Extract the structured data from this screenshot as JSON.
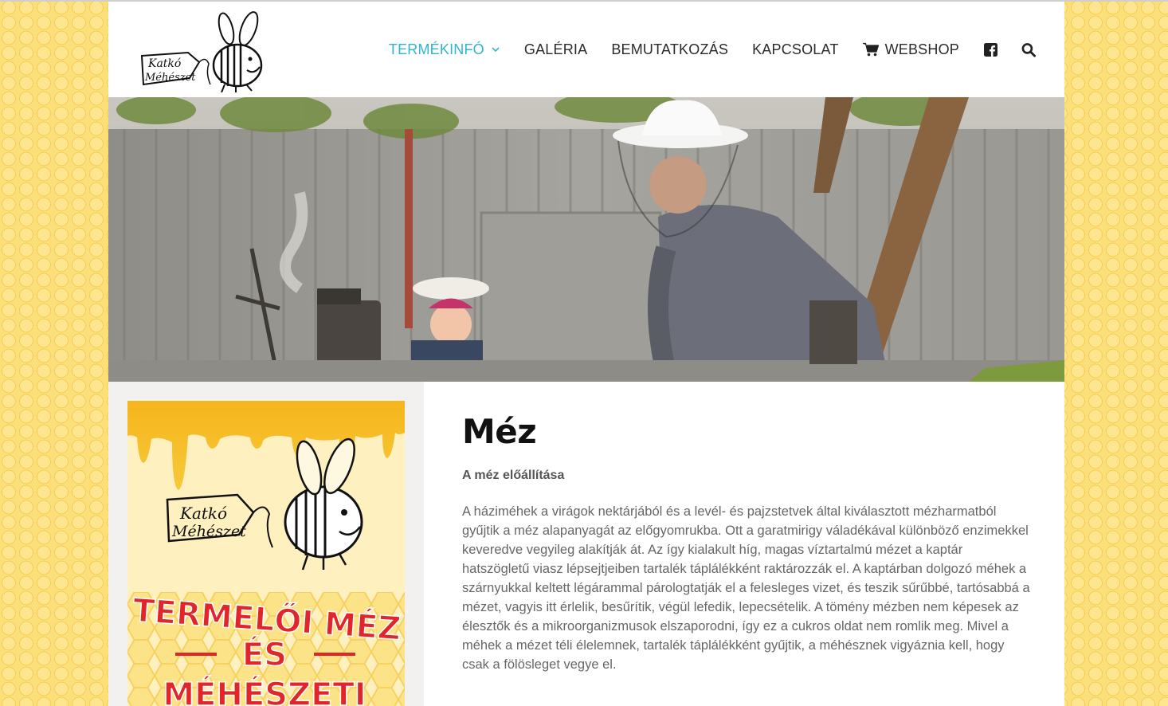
{
  "brand": {
    "logo_line1": "Katkó",
    "logo_line2": "Méhészet"
  },
  "nav": {
    "items": [
      {
        "label": "TERMÉKINFÓ"
      },
      {
        "label": "GALÉRIA"
      },
      {
        "label": "BEMUTATKOZÁS"
      },
      {
        "label": "KAPCSOLAT"
      },
      {
        "label": "WEBSHOP"
      }
    ]
  },
  "poster": {
    "logo_line1": "Katkó",
    "logo_line2": "Méhészet",
    "line1": "TERMELŐI MÉZ",
    "line2": "ÉS",
    "line3": "MÉHÉSZETI"
  },
  "article": {
    "title": "Méz",
    "subtitle": "A méz előállítása",
    "body": "A háziméhek a virágok nektárjából és a levél- és pajzstetvek által kiválasztott mézharmatból gyűjtik a méz alapanyagát az előgyomrukba. Ott a garatmirigy váladékával különböző enzimekkel keveredve vegyileg alakítják át. Az így kialakult híg, magas víztartalmú mézet a kaptár hatszögletű viasz lépsejtjeiben tartalék táplálékként raktározzák el. A kaptárban dolgozó méhek a szárnyukkal keltett légárammal párologtatják el a felesleges vizet, és teszik sűrűbbé, tartósabbá a mézet, vagyis itt érlelik, besűrítik, végül lefedik, lepecsételik. A tömény mézben nem képesek az élesztők és a mikroorganizmusok elszaporodni, így ez a cukros oldat nem romlik meg. Mivel a méhek a mézet téli élelemnek, tartalék táplálékként gyűjtik, a méhésznek vigyáznia kell, hogy csak a fölösleget vegye el."
  },
  "colors": {
    "accent": "#2fb5d2",
    "honey": "#f3c53f",
    "poster_red": "#e0262b"
  },
  "icons": [
    "chevron-down-icon",
    "cart-icon",
    "facebook-icon",
    "search-icon",
    "bee-icon"
  ]
}
